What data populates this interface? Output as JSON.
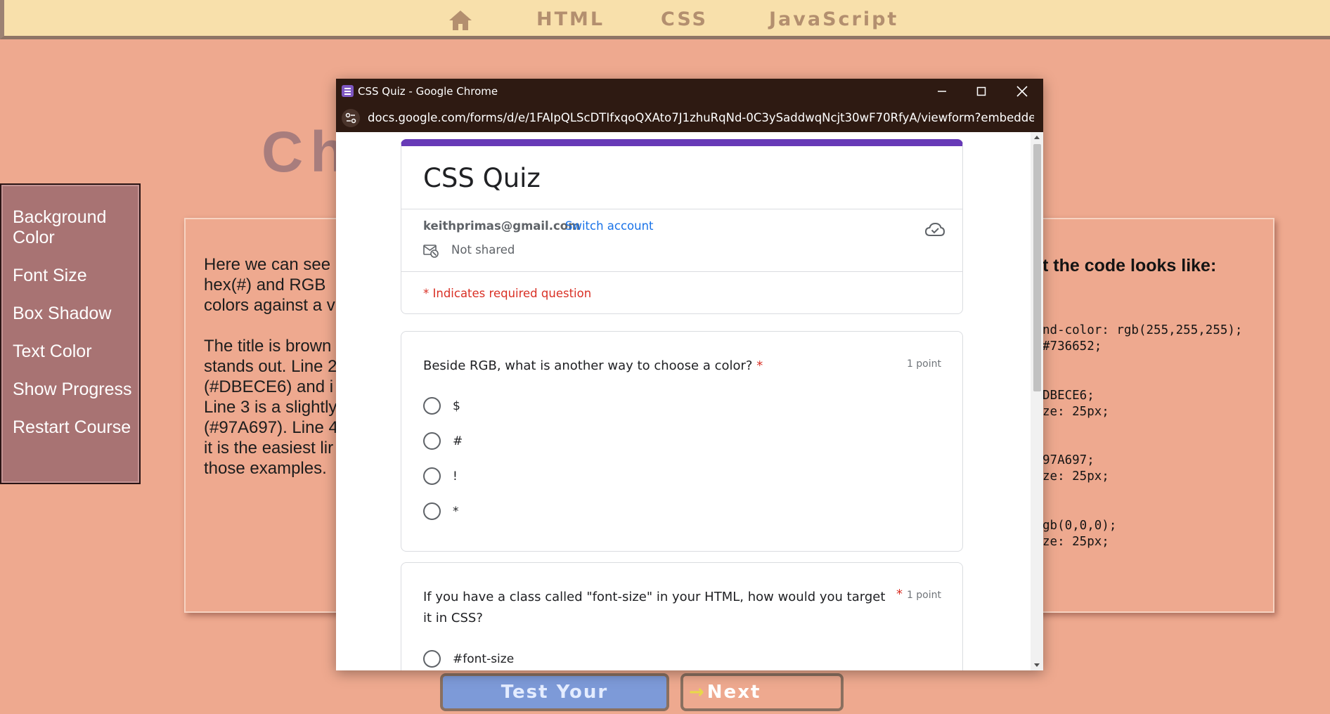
{
  "nav": {
    "home_icon": "home-icon",
    "links": [
      "HTML",
      "CSS",
      "JavaScript"
    ]
  },
  "page": {
    "title_fragment": "Ch"
  },
  "sidebar": {
    "items": [
      "Background Color",
      "Font Size",
      "Box Shadow",
      "Text Color",
      "Show Progress",
      "Restart Course"
    ]
  },
  "content": {
    "left_paragraphs": [
      "Here we can see hex(#) and RGB colors against a v",
      "The title is brown stands out. Line 2 (#DBECE6) and i Line 3 is a slightly (#97A697). Line 4 it is the easiest lir those examples."
    ],
    "right_heading": "t the code looks like:",
    "code_blocks": [
      "nd-color: rgb(255,255,255);\n#736652;",
      "DBECE6;\nze: 25px;",
      "97A697;\nze: 25px;",
      "gb(0,0,0);\nze: 25px;"
    ]
  },
  "buttons": {
    "test": "Test Your Knowledge",
    "next": "Next Lesson",
    "next_arrow": "→"
  },
  "chrome": {
    "window_title": "CSS Quiz - Google Chrome",
    "url": "docs.google.com/forms/d/e/1FAIpQLScDTIfxqoQXAto7J1zhuRqNd-0C3ySaddwqNcjt30wF70RfyA/viewform?embedded..."
  },
  "form": {
    "title": "CSS Quiz",
    "email": "keithprimas@gmail.com",
    "switch_account": "Switch account",
    "not_shared": "Not shared",
    "required_note": "* Indicates required question",
    "questions": [
      {
        "text": "Beside RGB, what is another way to choose a color?",
        "required_mark": "*",
        "points": "1 point",
        "options": [
          "$",
          "#",
          "!",
          "*"
        ]
      },
      {
        "text": "If you have a class called \"font-size\" in your HTML, how would you target it in CSS?",
        "required_mark": "*",
        "points": "1 point",
        "options": [
          "#font-size"
        ]
      }
    ]
  },
  "colors": {
    "accent_purple": "#673ab7",
    "link_blue": "#1a73e8",
    "required_red": "#d93025",
    "page_bg": "#eea98f",
    "nav_bg": "#f8e0ab",
    "sidebar_bg": "#a87373"
  }
}
